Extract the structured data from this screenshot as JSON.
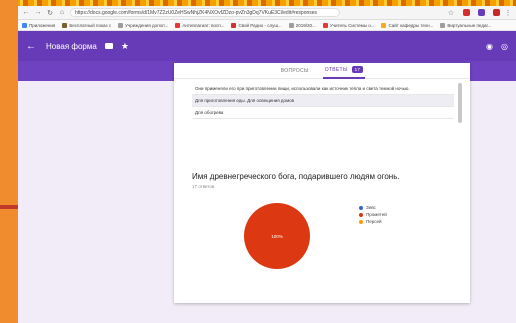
{
  "browser": {
    "url": "https://docs.google.com/forms/d/1Mv7Z2zU0ZeHSwNhjZK4NXOvfZDzo-pvZn3gDq7VKuE3Cl/edit#responses"
  },
  "bookmarks": [
    {
      "label": "Приложения",
      "color": "#4285f4"
    },
    {
      "label": "Бесплатный показ с",
      "color": "#7b5e2f"
    },
    {
      "label": "Учреждения допол...",
      "color": "#9e9e9e"
    },
    {
      "label": "Антиплагиат: восп...",
      "color": "#e53935"
    },
    {
      "label": "Свой Радио - слуш...",
      "color": "#d32f2f"
    },
    {
      "label": "2019/20...",
      "color": "#9e9e9e"
    },
    {
      "label": "Учитель Системы о...",
      "color": "#e53935"
    },
    {
      "label": "Сайт кафедры техн...",
      "color": "#f9a825"
    },
    {
      "label": "Виртуальные педаг...",
      "color": "#9e9e9e"
    }
  ],
  "header": {
    "back_icon": "←",
    "title": "Новая форма",
    "star_icon": "★",
    "palette_icon": "◉",
    "preview_icon": "◎"
  },
  "tabs": {
    "questions": "ВОПРОСЫ",
    "responses": "ОТВЕТЫ",
    "responses_count": "17"
  },
  "answers": [
    {
      "text": "Они применяли его при приготовлении пищи, использовали как источник тепла и света темной ночью.",
      "shaded": false
    },
    {
      "text": "Для приготовления еды. Для освещения домов",
      "shaded": true
    },
    {
      "text": "Для обогрева",
      "shaded": false
    }
  ],
  "question": {
    "title": "Имя древнегреческого бога, подарившего людям огонь.",
    "count": "17 ответов"
  },
  "chart_data": {
    "type": "pie",
    "slice_label": "100%",
    "series": [
      {
        "name": "Зевс",
        "value": 0,
        "color": "#3366cc"
      },
      {
        "name": "Прометей",
        "value": 100,
        "color": "#dc3912"
      },
      {
        "name": "Персей",
        "value": 0,
        "color": "#ff9900"
      }
    ]
  }
}
